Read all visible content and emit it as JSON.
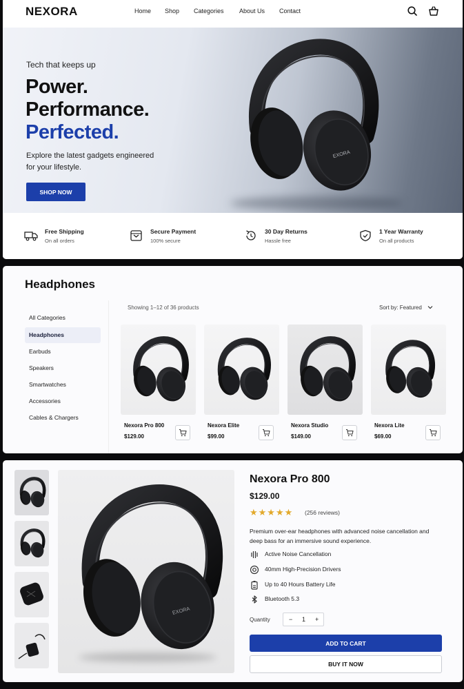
{
  "brand": "NEXORA",
  "nav": {
    "links": [
      "Home",
      "Shop",
      "Categories",
      "About Us",
      "Contact"
    ],
    "icons": [
      "search-icon",
      "bag-icon"
    ]
  },
  "hero": {
    "tagline": "Tech that keeps up",
    "headline": [
      "Power.",
      "Performance.",
      "Perfected."
    ],
    "subtitle": [
      "Explore the latest gadgets engineered",
      "for your lifestyle."
    ],
    "cta": "SHOP NOW",
    "product_logo": "EXORA",
    "accent_color": "#1c3faa"
  },
  "features": [
    {
      "icon": "truck-icon",
      "title": "Free Shipping",
      "subtitle": "On all orders"
    },
    {
      "icon": "card-icon",
      "title": "Secure Payment",
      "subtitle": "100% secure"
    },
    {
      "icon": "return-icon",
      "title": "30 Day Returns",
      "subtitle": "Hassle free"
    },
    {
      "icon": "shield-icon",
      "title": "1 Year Warranty",
      "subtitle": "On all products"
    }
  ],
  "category": {
    "title": "Headphones",
    "sidebar": [
      "All Categories",
      "Headphones",
      "Earbuds",
      "Speakers",
      "Smartwatches",
      "Accessories",
      "Cables & Chargers"
    ],
    "active_index": 1,
    "showing": "Showing 1–12 of 36 products",
    "sort": "Sort by:  Featured",
    "products": [
      {
        "name": "Nexora Pro 800",
        "price": "$129.00"
      },
      {
        "name": "Nexora Elite",
        "price": "$99.00"
      },
      {
        "name": "Nexora Studio",
        "price": "$149.00"
      },
      {
        "name": "Nexora Lite",
        "price": "$69.00"
      }
    ]
  },
  "product": {
    "title": "Nexora Pro 800",
    "price": "$129.00",
    "rating": 4.5,
    "stars": "★★★★★",
    "reviews": "(256 reviews)",
    "description": "Premium over-ear headphones with advanced noise cancellation and deep bass for an immersive sound experience.",
    "specs": [
      {
        "icon": "noise-cancel-icon",
        "text": "Active Noise Cancellation"
      },
      {
        "icon": "driver-icon",
        "text": "40mm High-Precision Drivers"
      },
      {
        "icon": "battery-icon",
        "text": "Up to 40 Hours Battery Life"
      },
      {
        "icon": "bluetooth-icon",
        "text": "Bluetooth 5.3"
      }
    ],
    "quantity_label": "Quantity",
    "quantity_minus": "−",
    "quantity": "1",
    "quantity_plus": "+",
    "add_to_cart": "ADD TO CART",
    "buy_now": "BUY IT NOW",
    "product_logo": "EXORA"
  }
}
